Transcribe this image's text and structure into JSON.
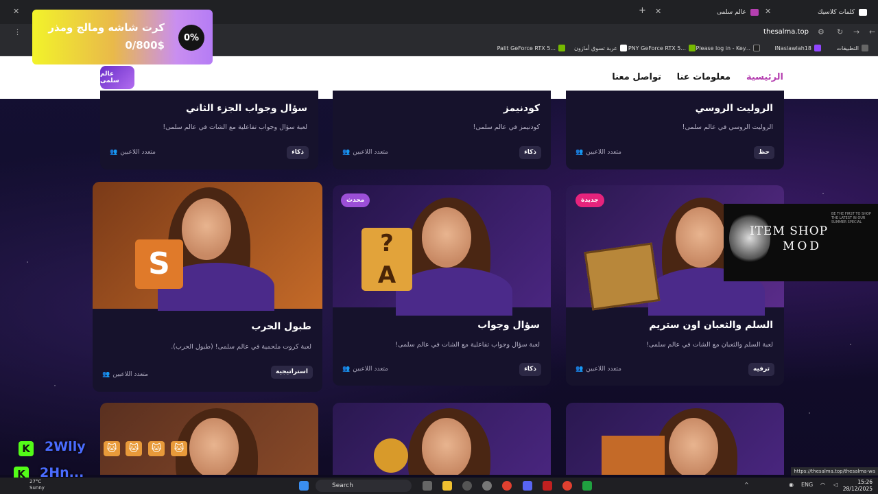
{
  "browser": {
    "tabs": [
      {
        "title": "كلمات كلاسيك"
      },
      {
        "title": "عالم سلمى"
      }
    ],
    "url": "thesalma.top",
    "bookmarks": [
      "التطبيقات",
      "INaslawlah18",
      "Please log in - Key...",
      "PNY GeForce RTX 5...",
      "عربة تسوق أمازون",
      "Palit GeForce RTX 5..."
    ],
    "status_url": "https://thesalma.top/thesalma-wa"
  },
  "nav": {
    "logo_text": "عالم سلمى",
    "links": [
      "الرئيسية",
      "معلومات عنا",
      "تواصل معنا"
    ]
  },
  "cards_top": [
    {
      "title": "الروليت الروسي",
      "desc": "الروليت الروسي في عالم سلمى!",
      "tag": "حظ",
      "players": "متعدد اللاعبين"
    },
    {
      "title": "كودنيمز",
      "desc": "كودنيمز في عالم سلمى!",
      "tag": "ذكاء",
      "players": "متعدد اللاعبين"
    },
    {
      "title": "سؤال وجواب الجزء الثاني",
      "desc": "لعبة سؤال وجواب تفاعلية مع الشات في عالم سلمى!",
      "tag": "ذكاء",
      "players": "متعدد اللاعبين"
    }
  ],
  "cards_mid": [
    {
      "title": "السلم والثعبان اون ستريم",
      "desc": "لعبة السلم والثعبان مع الشات في عالم سلمى!",
      "tag": "ترفيه",
      "players": "متعدد اللاعبين",
      "badge": "جديدة"
    },
    {
      "title": "سؤال وجواب",
      "desc": "لعبة سؤال وجواب تفاعلية مع الشات في عالم سلمى!",
      "tag": "ذكاء",
      "players": "متعدد اللاعبين",
      "badge": "محدث"
    },
    {
      "title": "طبول الحرب",
      "desc": "لعبة كروت ملحمية في عالم سلمى! (طبول الحرب).",
      "tag": "استراتيجية",
      "players": "متعدد اللاعبين"
    }
  ],
  "progress_popup": {
    "title": "كرت شاشه ومالج ومذر",
    "value": "0/800$",
    "percent": "0%"
  },
  "item_shop": {
    "line1": "ITEM SHOP",
    "line2": "MOD",
    "small": "BE THE FIRST TO SHOP THE LATEST IN OUR SUMMER SPECIAL"
  },
  "stream": {
    "name1": "2Wlly",
    "name2": "2Hn...",
    "k": "K"
  },
  "taskbar": {
    "temp": "27°C",
    "weather": "Sunny",
    "search": "Search",
    "lang": "ENG",
    "time": "15:26",
    "date": "28/12/2025"
  },
  "colors": {
    "accent": "#b53fb0",
    "new_badge": "#e6237c",
    "updated_badge": "#9b4fd6"
  }
}
